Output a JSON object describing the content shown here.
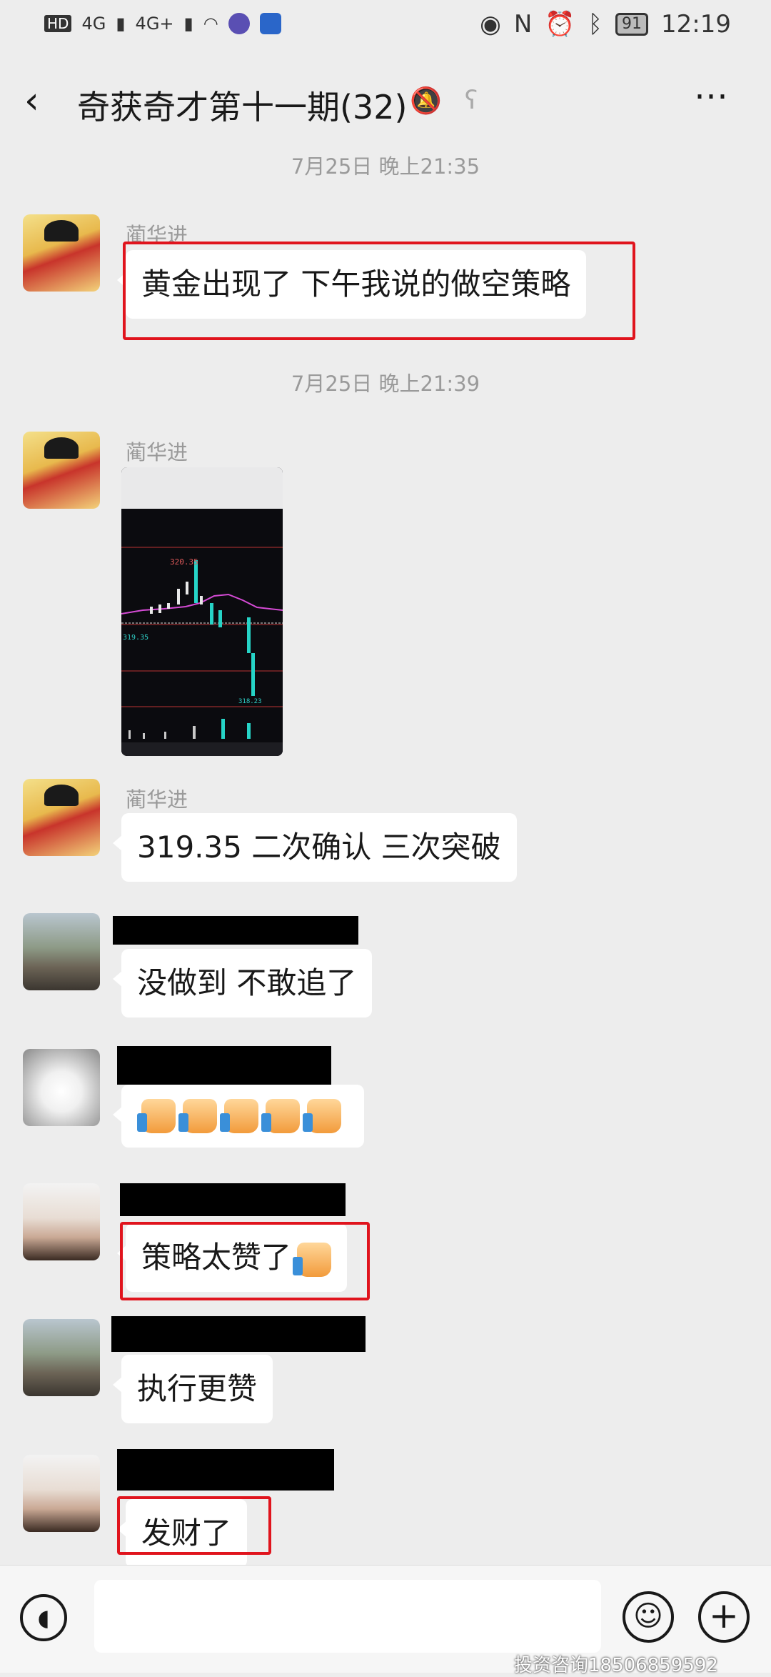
{
  "status": {
    "network_left": "HD",
    "signal1": "4G",
    "signal2": "4G+",
    "battery": "91",
    "time": "12:19"
  },
  "header": {
    "back_icon": "chevron-left-icon",
    "title": "奇获奇才第十一期(32)",
    "mute_icon": "bell-off-icon",
    "earpiece_icon": "ear-icon",
    "more_icon": "more-dots-icon"
  },
  "timestamps": [
    "7月25日 晚上21:35",
    "7月25日 晚上21:39"
  ],
  "messages": [
    {
      "sender": "蔺华进",
      "text": "黄金出现了 下午我说的做空策略"
    },
    {
      "sender": "蔺华进",
      "type": "image"
    },
    {
      "sender": "蔺华进",
      "text": "319.35 二次确认 三次突破"
    },
    {
      "sender": "",
      "text": "没做到  不敢追了"
    },
    {
      "sender": "",
      "type": "emoji",
      "count": 5
    },
    {
      "sender": "",
      "text": "策略太赞了"
    },
    {
      "sender": "",
      "text": "执行更赞"
    },
    {
      "sender": "",
      "text": "发财了"
    }
  ],
  "chart_image": {
    "label_high": "320.35",
    "label_mid": "319.35",
    "label_low": "318.23"
  },
  "composer": {
    "voice_icon": "voice-icon",
    "emoji_icon": "emoji-icon",
    "plus_icon": "plus-icon"
  },
  "watermark": "投资咨询18506859592",
  "colors": {
    "highlight": "#e0141d",
    "background": "#ededed"
  }
}
